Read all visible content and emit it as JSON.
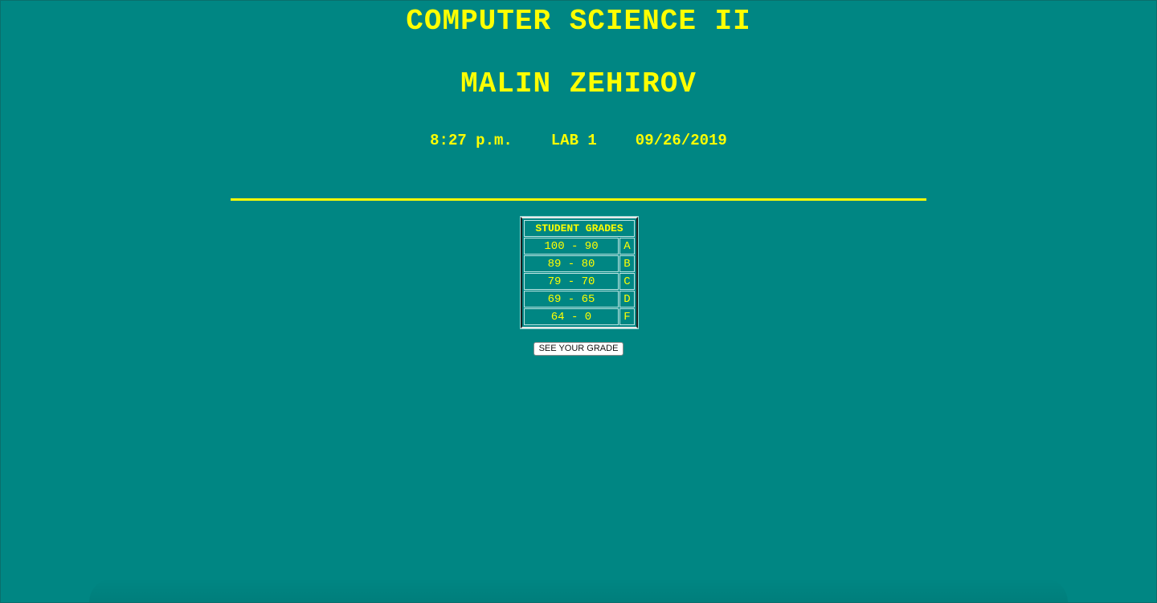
{
  "header": {
    "course_title": "COMPUTER SCIENCE II",
    "student_name": "MALIN ZEHIROV",
    "time": "8:27 p.m.",
    "lab": "LAB 1",
    "date": "09/26/2019"
  },
  "grades_table": {
    "heading": "STUDENT GRADES",
    "rows": [
      {
        "range": "100 - 90",
        "letter": "A"
      },
      {
        "range": "89 - 80",
        "letter": "B"
      },
      {
        "range": "79 - 70",
        "letter": "C"
      },
      {
        "range": "69 - 65",
        "letter": "D"
      },
      {
        "range": "64 - 0",
        "letter": "F"
      }
    ]
  },
  "actions": {
    "see_grade_label": "SEE YOUR GRADE"
  },
  "colors": {
    "background": "#008683",
    "text": "#ffff00",
    "button_bg": "#ffffff"
  }
}
